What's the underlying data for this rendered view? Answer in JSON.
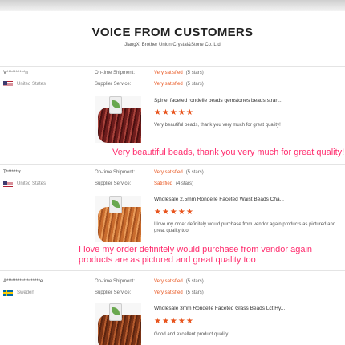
{
  "header": {
    "title": "VOICE FROM CUSTOMERS",
    "subtitle": "JiangXi Brother Union Crystal&Stone Co.,Ltd"
  },
  "labels": {
    "ontime": "On-time Shipment:",
    "service": "Supplier Service:"
  },
  "colors": {
    "accent": "#e8541d",
    "highlight": "#ff2d6e"
  },
  "reviews": [
    {
      "user": "V**********n",
      "country": "United States",
      "flag_icon": "us-flag-icon",
      "shipment": "Very satisfied",
      "shipment_stars": "(5 stars)",
      "service": "Very satisfied",
      "service_stars": "(5 stars)",
      "product": "Spinel faceted rondelle beads gemstones beads stran...",
      "rating": "★★★★★",
      "comment": "Very beautiful beads, thank you very much for great quality!",
      "highlight": "Very beautiful beads, thank you very much for great quality!"
    },
    {
      "user": "T*******r",
      "country": "United States",
      "flag_icon": "us-flag-icon",
      "shipment": "Very satisfied",
      "shipment_stars": "(5 stars)",
      "service": "Satisfied",
      "service_stars": "(4 stars)",
      "product": "Wholesale 2.5mm Rondelle Faceted Waist Beads Cha...",
      "rating": "★★★★★",
      "comment": "I love my order definitely would purchase from vendor again products as pictured and great quality too",
      "highlight": "I love my order definitely would purchase from vendor again products are as pictured and great quality too"
    },
    {
      "user": "A******************e",
      "country": "Sweden",
      "flag_icon": "sweden-flag-icon",
      "shipment": "Very satisfied",
      "shipment_stars": "(5 stars)",
      "service": "Very satisfied",
      "service_stars": "(5 stars)",
      "product": "Wholesale 3mm Rondelle Faceted Glass Beads Lct Hy...",
      "rating": "★★★★★",
      "comment": "Good and excellent product quality"
    }
  ]
}
